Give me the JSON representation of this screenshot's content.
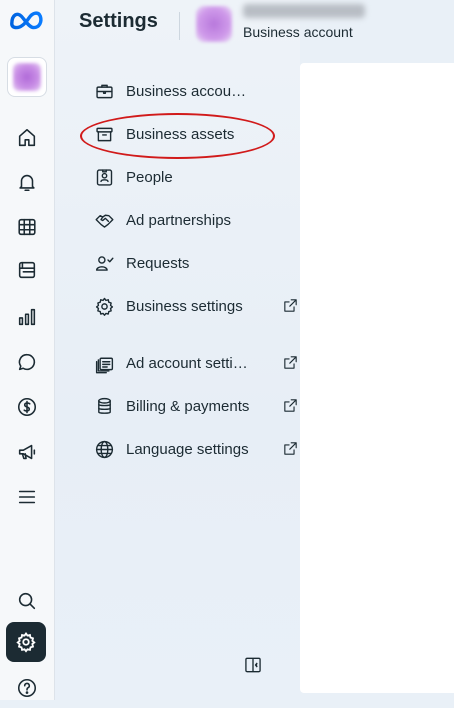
{
  "header": {
    "title": "Settings",
    "business_subtitle": "Business account"
  },
  "rail": {
    "items": [
      {
        "name": "home-icon"
      },
      {
        "name": "bell-icon"
      },
      {
        "name": "table-icon"
      },
      {
        "name": "pages-icon"
      },
      {
        "name": "bar-chart-icon"
      },
      {
        "name": "chat-icon"
      },
      {
        "name": "dollar-icon"
      },
      {
        "name": "megaphone-icon"
      },
      {
        "name": "menu-icon"
      },
      {
        "name": "search-icon"
      },
      {
        "name": "gear-icon"
      },
      {
        "name": "help-icon"
      }
    ]
  },
  "nav": {
    "items": [
      {
        "label": "Business account info",
        "icon": "briefcase-icon",
        "external": false
      },
      {
        "label": "Business assets",
        "icon": "archive-box-icon",
        "external": false,
        "highlighted": true
      },
      {
        "label": "People",
        "icon": "id-card-icon",
        "external": false
      },
      {
        "label": "Ad partnerships",
        "icon": "handshake-icon",
        "external": false
      },
      {
        "label": "Requests",
        "icon": "person-check-icon",
        "external": false
      },
      {
        "label": "Business settings",
        "icon": "gear-icon",
        "external": true
      },
      {
        "label": "Ad account settings",
        "icon": "ad-account-icon",
        "external": true
      },
      {
        "label": "Billing & payments",
        "icon": "coins-icon",
        "external": true
      },
      {
        "label": "Language settings",
        "icon": "globe-icon",
        "external": true
      }
    ]
  },
  "colors": {
    "accent": "#0866ff",
    "text": "#1c2b33",
    "highlight": "#d11a1a"
  }
}
